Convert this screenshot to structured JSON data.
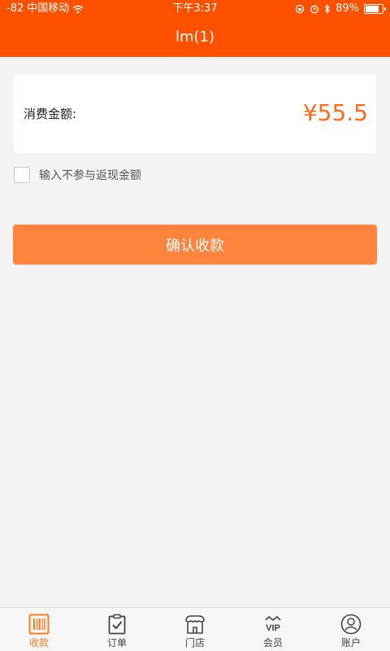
{
  "status_bar": {
    "signal": "-82",
    "carrier": "中国移动",
    "time": "下午3:37",
    "battery": "89%",
    "battery_level": 0.89
  },
  "header": {
    "title": "lm(1)"
  },
  "amount": {
    "label": "消费金额:",
    "value": "¥55.5"
  },
  "exclude_checkbox": {
    "label": "输入不参与返现金额",
    "checked": false
  },
  "confirm_button": {
    "label": "确认收款"
  },
  "tabbar": {
    "items": [
      {
        "label": "收款",
        "icon": "barcode-icon",
        "active": true
      },
      {
        "label": "订单",
        "icon": "clipboard-check-icon",
        "active": false
      },
      {
        "label": "门店",
        "icon": "store-icon",
        "active": false
      },
      {
        "label": "会员",
        "icon": "vip-crown-icon",
        "active": false,
        "icon_text": "VIP"
      },
      {
        "label": "账户",
        "icon": "user-icon",
        "active": false
      }
    ]
  },
  "colors": {
    "brand": "#fd5100",
    "button": "#fd843d",
    "amount": "#ff6a1a",
    "active_tab": "#ff7a1f"
  }
}
